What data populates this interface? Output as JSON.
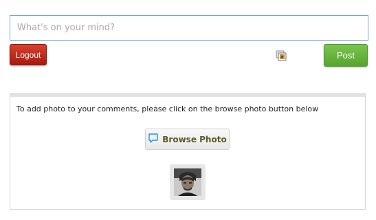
{
  "status": {
    "placeholder": "What's on your mind?"
  },
  "actions": {
    "logout_label": "Logout",
    "post_label": "Post",
    "photo_toggle_icon": "photo-stack-icon"
  },
  "upload": {
    "instructions": "To add photo to your comments, please click on the browse photo button below",
    "browse_label": "Browse Photo",
    "browse_icon": "speech-bubble-icon",
    "thumbnail_icon": "profile-photo-thumbnail"
  },
  "colors": {
    "input_border": "#6fa5d6",
    "logout_red": "#b8281a",
    "post_green": "#6ab83f",
    "browse_text": "#5a5a2a"
  }
}
